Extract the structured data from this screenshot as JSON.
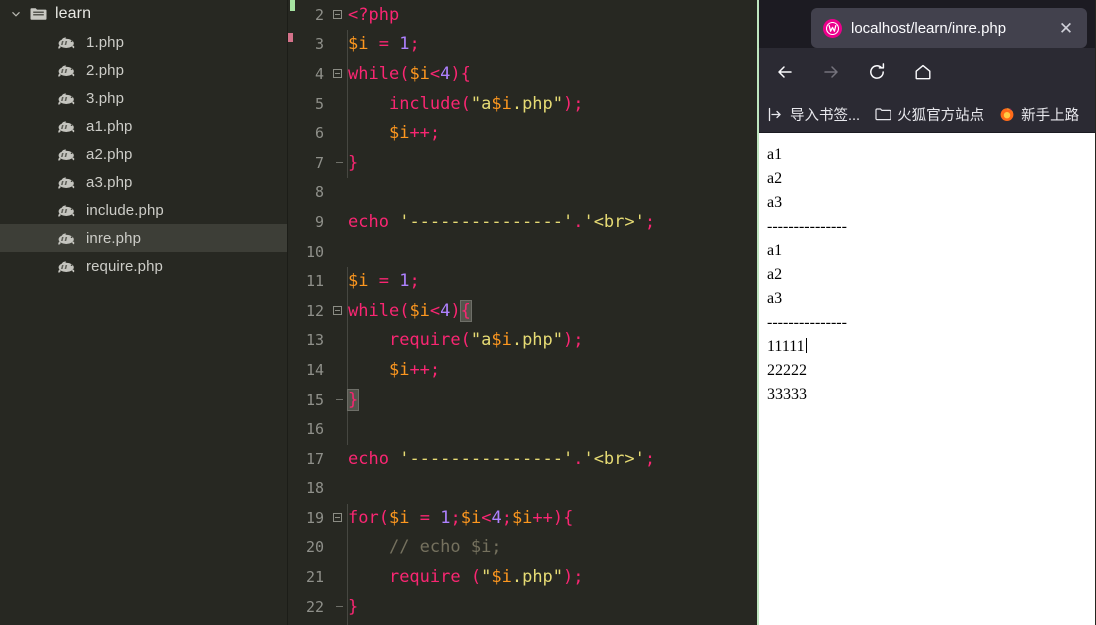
{
  "sidebar": {
    "folder": {
      "name": "learn",
      "icon": "folder-icon",
      "chevron": "chevron-down-icon",
      "expanded": true
    },
    "files": [
      {
        "name": "1.php",
        "icon": "php-file-icon",
        "selected": false
      },
      {
        "name": "2.php",
        "icon": "php-file-icon",
        "selected": false
      },
      {
        "name": "3.php",
        "icon": "php-file-icon",
        "selected": false
      },
      {
        "name": "a1.php",
        "icon": "php-file-icon",
        "selected": false
      },
      {
        "name": "a2.php",
        "icon": "php-file-icon",
        "selected": false
      },
      {
        "name": "a3.php",
        "icon": "php-file-icon",
        "selected": false
      },
      {
        "name": "include.php",
        "icon": "php-file-icon",
        "selected": false
      },
      {
        "name": "inre.php",
        "icon": "php-file-icon",
        "selected": true
      },
      {
        "name": "require.php",
        "icon": "php-file-icon",
        "selected": false
      }
    ]
  },
  "editor": {
    "language": "php",
    "theme": "Monokai",
    "first_visible_line": 2,
    "last_visible_line": 22,
    "colors": {
      "background": "#272822",
      "keyword": "#f92672",
      "variable": "#fd971f",
      "number": "#ae81ff",
      "string": "#e6db74",
      "comment": "#75715e",
      "plain": "#f8f8f2",
      "line_number": "#8f908a"
    },
    "lines": [
      {
        "num": "2",
        "fold": "collapse",
        "text": "<?php"
      },
      {
        "num": "3",
        "fold": "none",
        "text": "$i = 1;"
      },
      {
        "num": "4",
        "fold": "collapse",
        "text": "while($i<4){"
      },
      {
        "num": "5",
        "fold": "none",
        "text": "    include(\"a$i.php\");"
      },
      {
        "num": "6",
        "fold": "none",
        "text": "    $i++;"
      },
      {
        "num": "7",
        "fold": "end",
        "text": "}"
      },
      {
        "num": "8",
        "fold": "none",
        "text": ""
      },
      {
        "num": "9",
        "fold": "none",
        "text": "echo '---------------'.'<br>';"
      },
      {
        "num": "10",
        "fold": "none",
        "text": ""
      },
      {
        "num": "11",
        "fold": "none",
        "text": "$i = 1;"
      },
      {
        "num": "12",
        "fold": "collapse",
        "text": "while($i<4){"
      },
      {
        "num": "13",
        "fold": "none",
        "text": "    require(\"a$i.php\");"
      },
      {
        "num": "14",
        "fold": "none",
        "text": "    $i++;"
      },
      {
        "num": "15",
        "fold": "end",
        "text": "}"
      },
      {
        "num": "16",
        "fold": "none",
        "text": ""
      },
      {
        "num": "17",
        "fold": "none",
        "text": "echo '---------------'.'<br>';"
      },
      {
        "num": "18",
        "fold": "none",
        "text": ""
      },
      {
        "num": "19",
        "fold": "collapse",
        "text": "for($i = 1;$i<4;$i++){"
      },
      {
        "num": "20",
        "fold": "none",
        "text": "    // echo $i;"
      },
      {
        "num": "21",
        "fold": "none",
        "text": "    require (\"$i.php\");"
      },
      {
        "num": "22",
        "fold": "end",
        "text": "}"
      }
    ]
  },
  "browser": {
    "tab": {
      "title": "localhost/learn/inre.php",
      "favicon": "wamp-icon",
      "favicon_color": "#ec008c",
      "close_label": "✕"
    },
    "nav": {
      "back": "←",
      "forward": "→",
      "reload": "↻",
      "home": "⌂"
    },
    "bookmarks": [
      {
        "label": "导入书签...",
        "icon": "import-bookmarks-icon"
      },
      {
        "label": "火狐官方站点",
        "icon": "folder-icon"
      },
      {
        "label": "新手上路",
        "icon": "firefox-icon"
      }
    ],
    "page": {
      "lines": [
        "a1",
        "a2",
        "a3",
        "---------------",
        "a1",
        "a2",
        "a3",
        "---------------",
        "11111",
        "22222",
        "33333"
      ],
      "caret_line_index": 8
    }
  }
}
